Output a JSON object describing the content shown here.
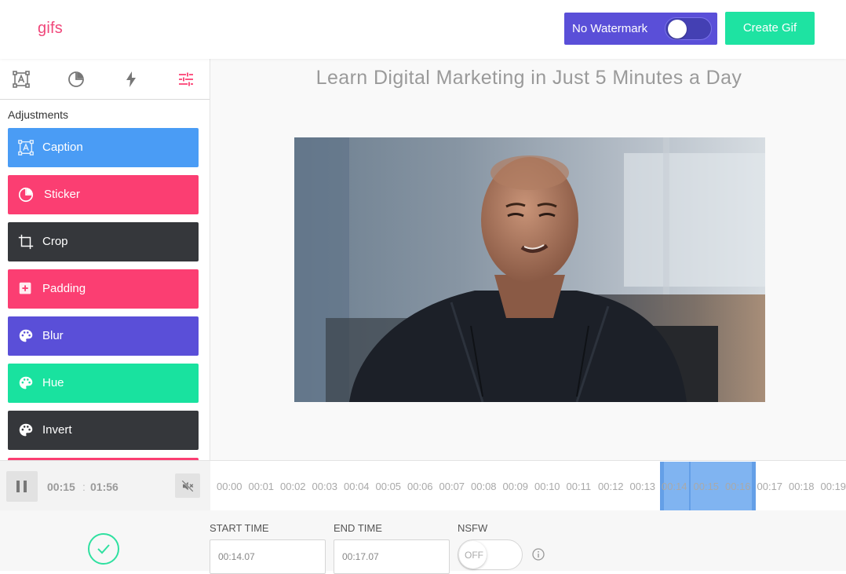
{
  "header": {
    "logo": "gifs",
    "watermark_label": "No Watermark",
    "watermark_enabled": false,
    "create_label": "Create Gif"
  },
  "colors": {
    "brand_pink": "#f0477a",
    "watermark_purple": "#5a4fd8",
    "create_green": "#1ee3a2"
  },
  "sidebar": {
    "tabs": [
      {
        "icon": "caption-frame-icon",
        "active": false
      },
      {
        "icon": "sticker-icon",
        "active": false
      },
      {
        "icon": "lightning-icon",
        "active": false
      },
      {
        "icon": "sliders-icon",
        "active": true
      }
    ],
    "section_title": "Adjustments",
    "items": [
      {
        "label": "Caption",
        "icon": "caption-frame-icon",
        "color": "#4a9cf5"
      },
      {
        "label": "Sticker",
        "icon": "sticker-icon",
        "color": "#fb3e72"
      },
      {
        "label": "Crop",
        "icon": "crop-icon",
        "color": "#35373b"
      },
      {
        "label": "Padding",
        "icon": "plus-square-icon",
        "color": "#fb3e72"
      },
      {
        "label": "Blur",
        "icon": "palette-icon",
        "color": "#5a4fd8"
      },
      {
        "label": "Hue",
        "icon": "palette-icon",
        "color": "#19e29f"
      },
      {
        "label": "Invert",
        "icon": "palette-icon",
        "color": "#35373b"
      }
    ]
  },
  "main": {
    "title": "Learn Digital Marketing in Just 5 Minutes a Day"
  },
  "player": {
    "current_time": "00:15",
    "separator": ":",
    "total_time": "01:56"
  },
  "timeline": {
    "ticks": [
      "00:00",
      "00:01",
      "00:02",
      "00:03",
      "00:04",
      "00:05",
      "00:06",
      "00:07",
      "00:08",
      "00:09",
      "00:10",
      "00:11",
      "00:12",
      "00:13",
      "00:14",
      "00:15",
      "00:16",
      "00:17",
      "00:18",
      "00:19"
    ]
  },
  "form": {
    "start_label": "START TIME",
    "start_value": "00:14.07",
    "end_label": "END TIME",
    "end_value": "00:17.07",
    "nsfw_label": "NSFW",
    "nsfw_state": "OFF"
  }
}
